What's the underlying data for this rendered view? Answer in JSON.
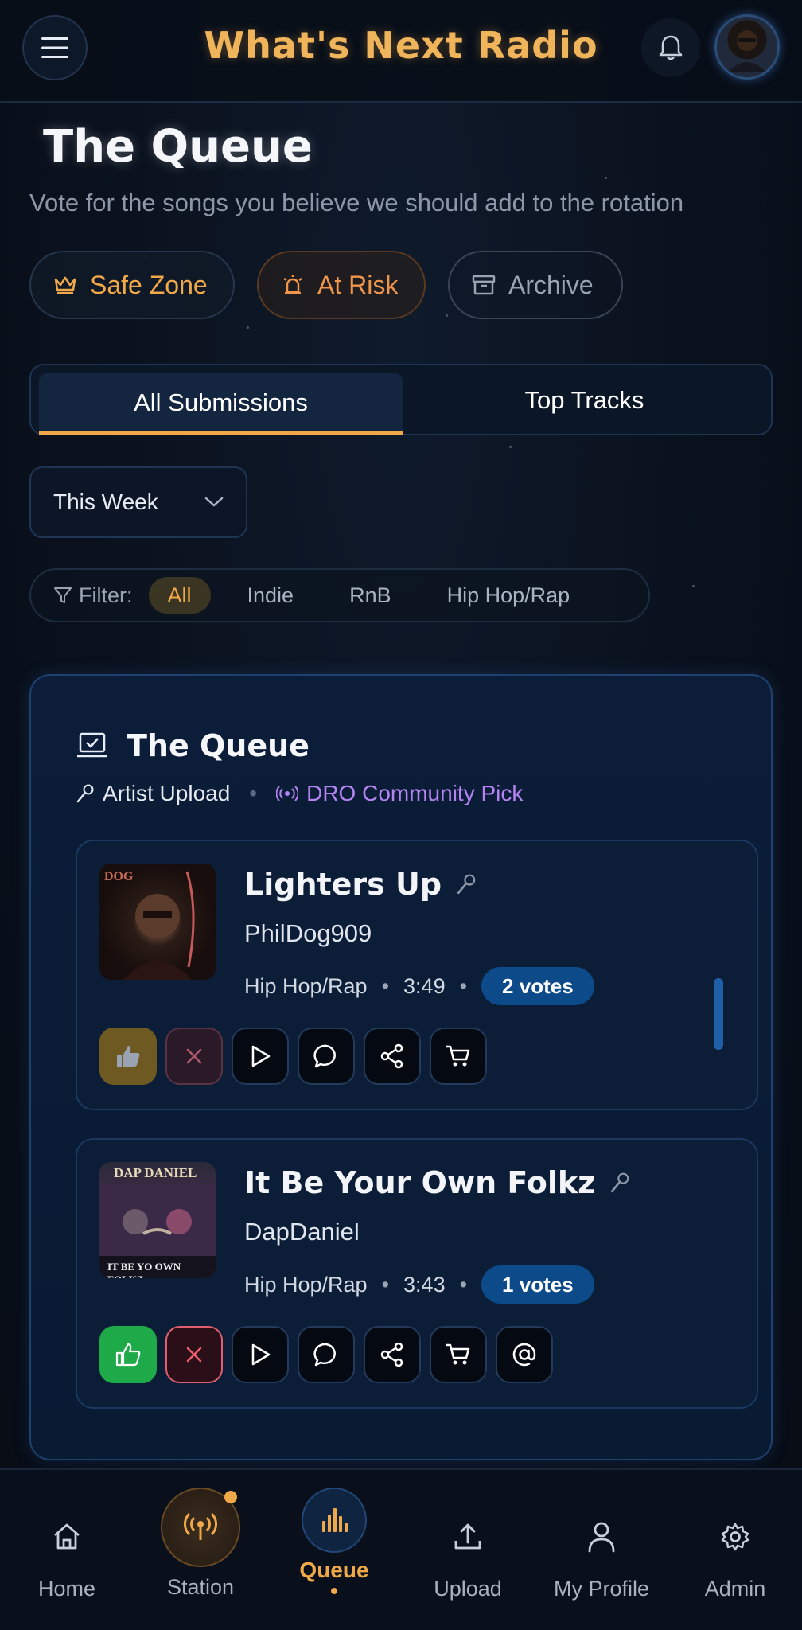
{
  "app": {
    "title": "What's Next Radio"
  },
  "page": {
    "title": "The Queue",
    "subtitle": "Vote for the songs you believe we should add to the rotation"
  },
  "zones": [
    {
      "label": "Safe Zone",
      "icon": "crown-icon"
    },
    {
      "label": "At Risk",
      "icon": "alarm-icon"
    },
    {
      "label": "Archive",
      "icon": "archive-icon"
    }
  ],
  "tabs": [
    {
      "label": "All Submissions",
      "active": true
    },
    {
      "label": "Top Tracks",
      "active": false
    }
  ],
  "period": {
    "selected": "This Week"
  },
  "filter": {
    "label": "Filter:",
    "options": [
      "All",
      "Indie",
      "RnB",
      "Hip Hop/Rap"
    ],
    "selected": "All"
  },
  "queue_card": {
    "title": "The Queue",
    "upload_label": "Artist Upload",
    "pick_label": "DRO Community Pick"
  },
  "tracks": [
    {
      "title": "Lighters Up",
      "artist": "PhilDog909",
      "genre": "Hip Hop/Rap",
      "duration": "3:49",
      "votes": "2 votes",
      "cover_text": "DOG"
    },
    {
      "title": "It Be Your Own Folkz",
      "artist": "DapDaniel",
      "genre": "Hip Hop/Rap",
      "duration": "3:43",
      "votes": "1 votes",
      "cover_top": "DAP DANIEL",
      "cover_bottom": "IT BE YO OWN FOLKZ"
    }
  ],
  "nav": [
    {
      "label": "Home",
      "icon": "home-icon"
    },
    {
      "label": "Station",
      "icon": "broadcast-icon"
    },
    {
      "label": "Queue",
      "icon": "equalizer-icon",
      "active": true
    },
    {
      "label": "Upload",
      "icon": "upload-icon"
    },
    {
      "label": "My Profile",
      "icon": "user-icon"
    },
    {
      "label": "Admin",
      "icon": "gear-icon"
    }
  ],
  "colors": {
    "accent": "#f0a848",
    "vote_badge": "#0d4a8a",
    "pick": "#b584f2",
    "like_active": "#1faa4a"
  }
}
